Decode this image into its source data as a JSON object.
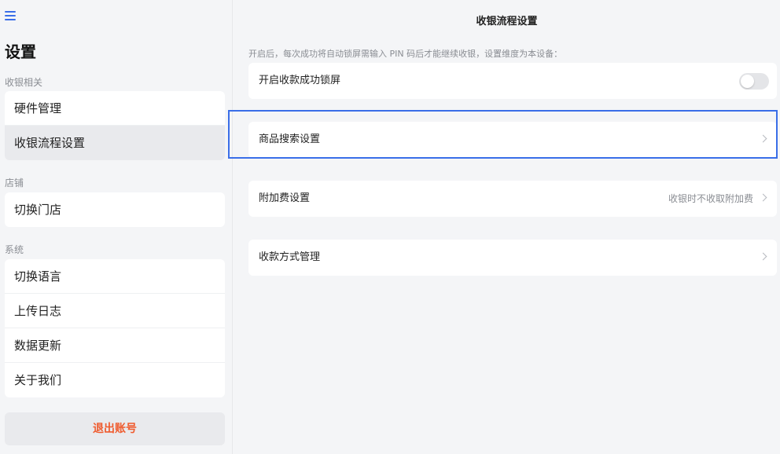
{
  "sidebar": {
    "title": "设置",
    "sections": [
      {
        "label": "收银相关",
        "items": [
          {
            "label": "硬件管理"
          },
          {
            "label": "收银流程设置"
          }
        ]
      },
      {
        "label": "店铺",
        "items": [
          {
            "label": "切换门店"
          }
        ]
      },
      {
        "label": "系统",
        "items": [
          {
            "label": "切换语言"
          },
          {
            "label": "上传日志"
          },
          {
            "label": "数据更新"
          },
          {
            "label": "关于我们"
          }
        ]
      }
    ],
    "logout_label": "退出账号"
  },
  "main": {
    "title": "收银流程设置",
    "hint": "开启后，每次成功将自动锁屏需输入 PIN 码后才能继续收银，设置维度为本设备：",
    "rows": [
      {
        "label": "开启收款成功锁屏",
        "toggle_on": false
      },
      {
        "label": "商品搜索设置"
      },
      {
        "label": "附加费设置",
        "value": "收银时不收取附加费"
      },
      {
        "label": "收款方式管理"
      }
    ]
  },
  "colors": {
    "accent": "#3a6ee8",
    "logout": "#ef5b2e",
    "active_item_bg": "#e9eaed"
  }
}
